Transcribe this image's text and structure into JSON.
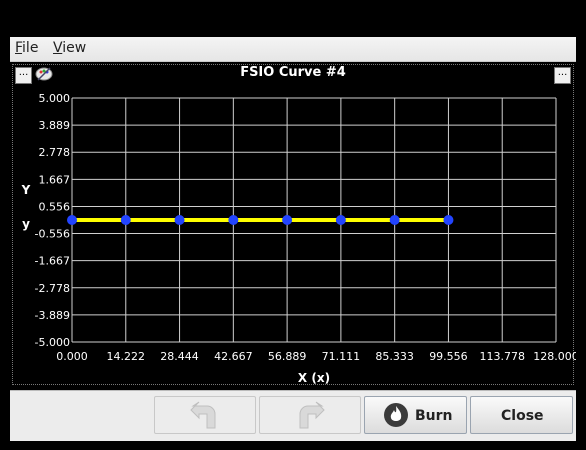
{
  "menu": {
    "file": "File",
    "view": "View"
  },
  "panel": {
    "title": "FSIO Curve #4",
    "menu_button": "..."
  },
  "chart_data": {
    "type": "line",
    "x_ticks": [
      "0.000",
      "14.222",
      "28.444",
      "42.667",
      "56.889",
      "71.111",
      "85.333",
      "99.556",
      "113.778",
      "128.000"
    ],
    "y_ticks": [
      "5.000",
      "3.889",
      "2.778",
      "1.667",
      "0.556",
      "-0.556",
      "-1.667",
      "-2.778",
      "-3.889",
      "-5.000"
    ],
    "xlim": [
      0,
      128
    ],
    "ylim": [
      -5,
      5
    ],
    "xlabel": "X (x)",
    "ylabel_top": "Y",
    "ylabel_bottom": "y",
    "series": [
      {
        "x": [
          0,
          14.222,
          28.444,
          42.667,
          56.889,
          71.111,
          85.333,
          99.556
        ],
        "y": [
          0,
          0,
          0,
          0,
          0,
          0,
          0,
          0
        ],
        "line_color": "#ffff00",
        "point_color": "#2244ff"
      }
    ],
    "grid": true
  },
  "buttons": {
    "undo": "",
    "redo": "",
    "burn": "Burn",
    "close": "Close"
  }
}
